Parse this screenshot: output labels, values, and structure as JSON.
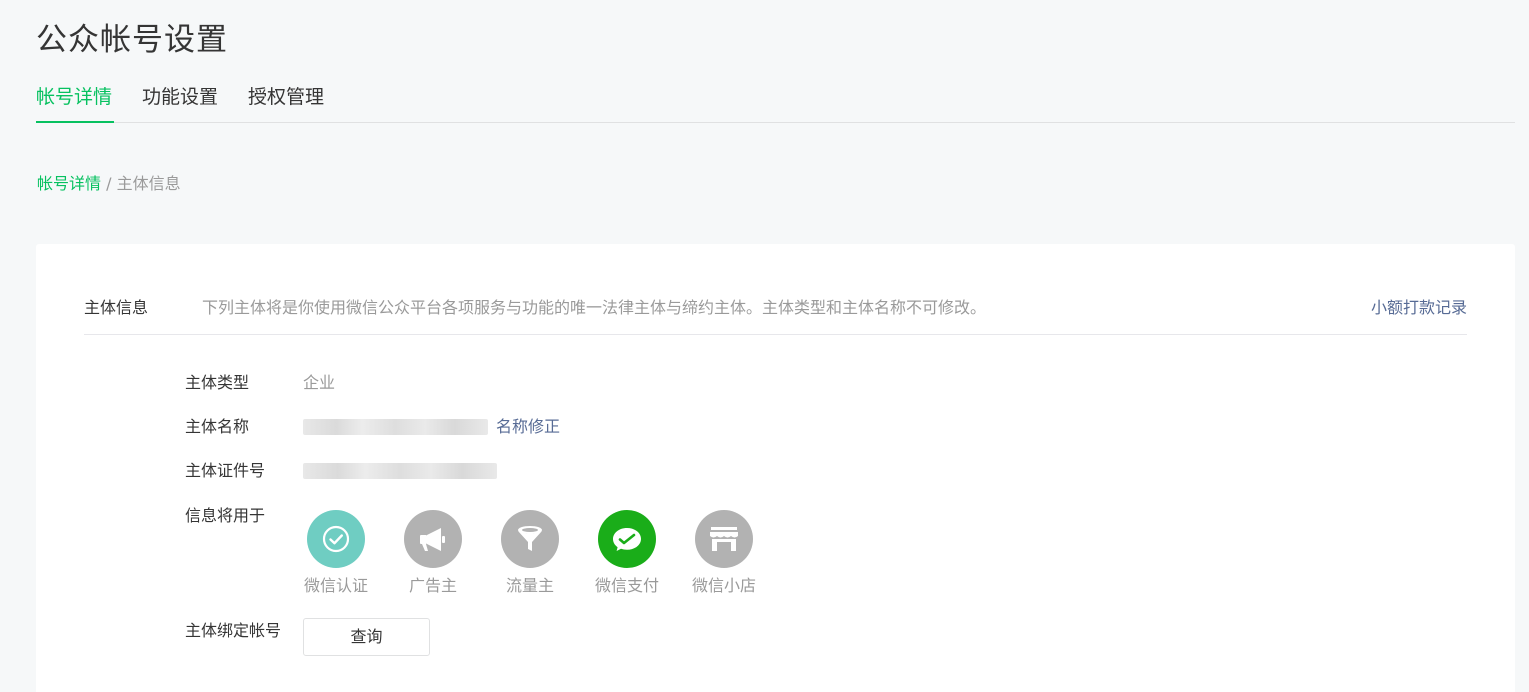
{
  "page_title": "公众帐号设置",
  "tabs": [
    {
      "label": "帐号详情",
      "active": true
    },
    {
      "label": "功能设置",
      "active": false
    },
    {
      "label": "授权管理",
      "active": false
    }
  ],
  "breadcrumb": {
    "link": "帐号详情",
    "separator": " / ",
    "current": "主体信息"
  },
  "section": {
    "title": "主体信息",
    "description": "下列主体将是你使用微信公众平台各项服务与功能的唯一法律主体与缔约主体。主体类型和主体名称不可修改。",
    "right_link": "小额打款记录"
  },
  "fields": {
    "type_label": "主体类型",
    "type_value": "企业",
    "name_label": "主体名称",
    "name_edit_link": "名称修正",
    "cert_label": "主体证件号",
    "usage_label": "信息将用于",
    "bound_label": "主体绑定帐号",
    "query_button": "查询"
  },
  "usages": [
    {
      "label": "微信认证",
      "icon": "check-icon",
      "color": "#6fcdc2"
    },
    {
      "label": "广告主",
      "icon": "megaphone-icon",
      "color": "#b2b2b2"
    },
    {
      "label": "流量主",
      "icon": "funnel-icon",
      "color": "#b2b2b2"
    },
    {
      "label": "微信支付",
      "icon": "wechat-pay-icon",
      "color": "#1aad19"
    },
    {
      "label": "微信小店",
      "icon": "store-icon",
      "color": "#b2b2b2"
    }
  ],
  "colors": {
    "accent": "#07c160",
    "link": "#576b95",
    "muted": "#9a9a9a"
  }
}
